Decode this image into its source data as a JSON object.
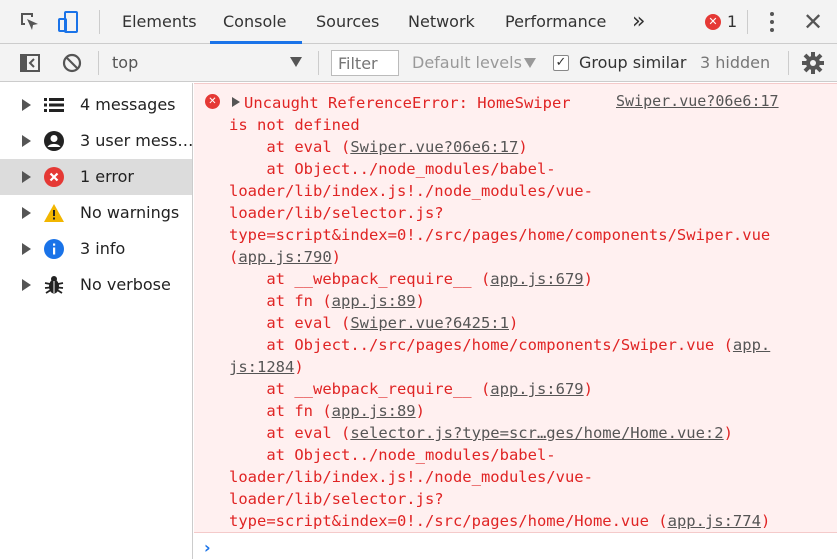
{
  "tabs": {
    "items": [
      "Elements",
      "Console",
      "Sources",
      "Network",
      "Performance"
    ],
    "active": "Console",
    "more_glyph": "»",
    "error_count": "1"
  },
  "toolbar": {
    "context": "top",
    "filter_placeholder": "Filter",
    "levels": "Default levels",
    "group_similar_label": "Group similar",
    "group_similar_checked": true,
    "hidden": "3 hidden"
  },
  "sidebar": {
    "items": [
      {
        "label": "4 messages",
        "icon": "list-icon"
      },
      {
        "label": "3 user mess…",
        "icon": "user-icon"
      },
      {
        "label": "1 error",
        "icon": "error-icon",
        "selected": true
      },
      {
        "label": "No warnings",
        "icon": "warning-icon"
      },
      {
        "label": "3 info",
        "icon": "info-icon"
      },
      {
        "label": "No verbose",
        "icon": "bug-icon"
      }
    ]
  },
  "message": {
    "source": "Swiper.vue?06e6:17",
    "lines": [
      {
        "text": "Uncaught ReferenceError: HomeSwiper"
      },
      {
        "text": "is not defined"
      },
      {
        "pre": "    at eval (",
        "link": "Swiper.vue?06e6:17",
        "post": ")"
      },
      {
        "pre": "    at Object../node_modules/babel-"
      },
      {
        "pre": "loader/lib/index.js!./node_modules/vue-"
      },
      {
        "pre": "loader/lib/selector.js?"
      },
      {
        "pre": "type=script&index=0!./src/pages/home/components/Swiper.vue"
      },
      {
        "pre": "(",
        "link": "app.js:790",
        "post": ")"
      },
      {
        "pre": "    at __webpack_require__ (",
        "link": "app.js:679",
        "post": ")"
      },
      {
        "pre": "    at fn (",
        "link": "app.js:89",
        "post": ")"
      },
      {
        "pre": "    at eval (",
        "link": "Swiper.vue?6425:1",
        "post": ")"
      },
      {
        "pre": "    at Object../src/pages/home/components/Swiper.vue (",
        "link": "app.",
        "post": ""
      },
      {
        "pre": "",
        "link": "js:1284",
        "post": ")"
      },
      {
        "pre": "    at __webpack_require__ (",
        "link": "app.js:679",
        "post": ")"
      },
      {
        "pre": "    at fn (",
        "link": "app.js:89",
        "post": ")"
      },
      {
        "pre": "    at eval (",
        "link": "selector.js?type=scr…ges/home/Home.vue:2",
        "post": ")"
      },
      {
        "pre": "    at Object../node_modules/babel-"
      },
      {
        "pre": "loader/lib/index.js!./node_modules/vue-"
      },
      {
        "pre": "loader/lib/selector.js?"
      },
      {
        "pre": "type=script&index=0!./src/pages/home/Home.vue (",
        "link": "app.js:774",
        "post": ")"
      }
    ]
  },
  "prompt": {
    "glyph": "›"
  },
  "colors": {
    "error": "#e02424",
    "error_bg": "#fff0f0",
    "accent": "#1a73e8"
  }
}
